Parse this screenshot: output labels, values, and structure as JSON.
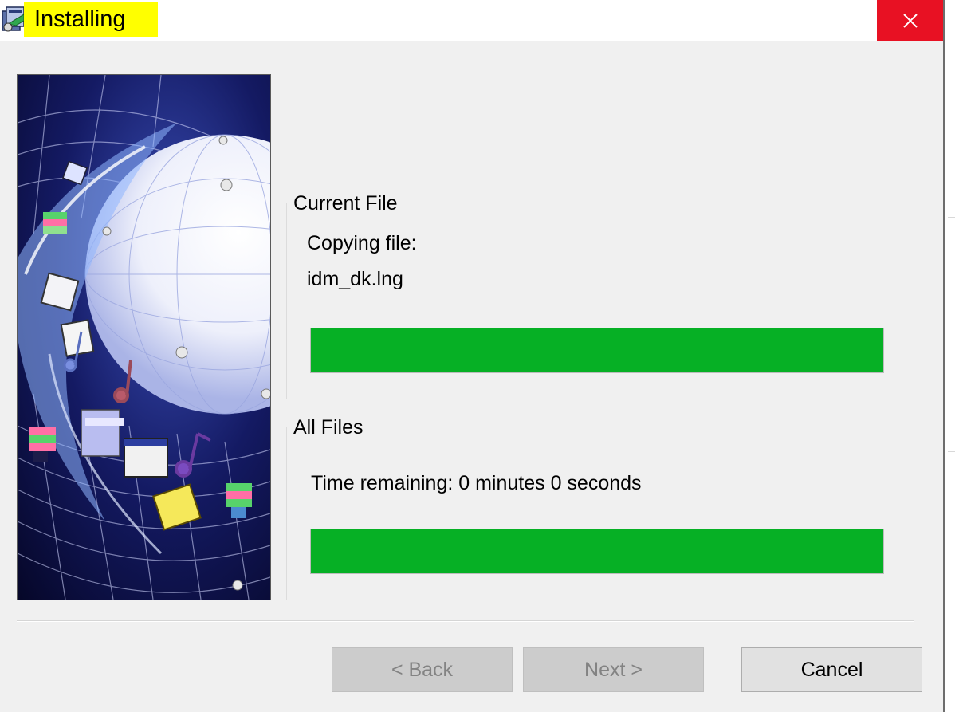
{
  "window": {
    "title": "Installing",
    "close_glyph": "✕",
    "icon": "setup-installer-icon",
    "close_color": "#e81123",
    "title_highlight_color": "#ffff00"
  },
  "current_file": {
    "legend": "Current File",
    "status": "Copying file:",
    "file_name": "idm_dk.lng",
    "progress_percent": 100
  },
  "all_files": {
    "legend": "All Files",
    "time_remaining": "Time remaining: 0 minutes 0 seconds",
    "progress_percent": 100
  },
  "progress_color": "#06b025",
  "buttons": {
    "back": "< Back",
    "next": "Next >",
    "cancel": "Cancel"
  }
}
